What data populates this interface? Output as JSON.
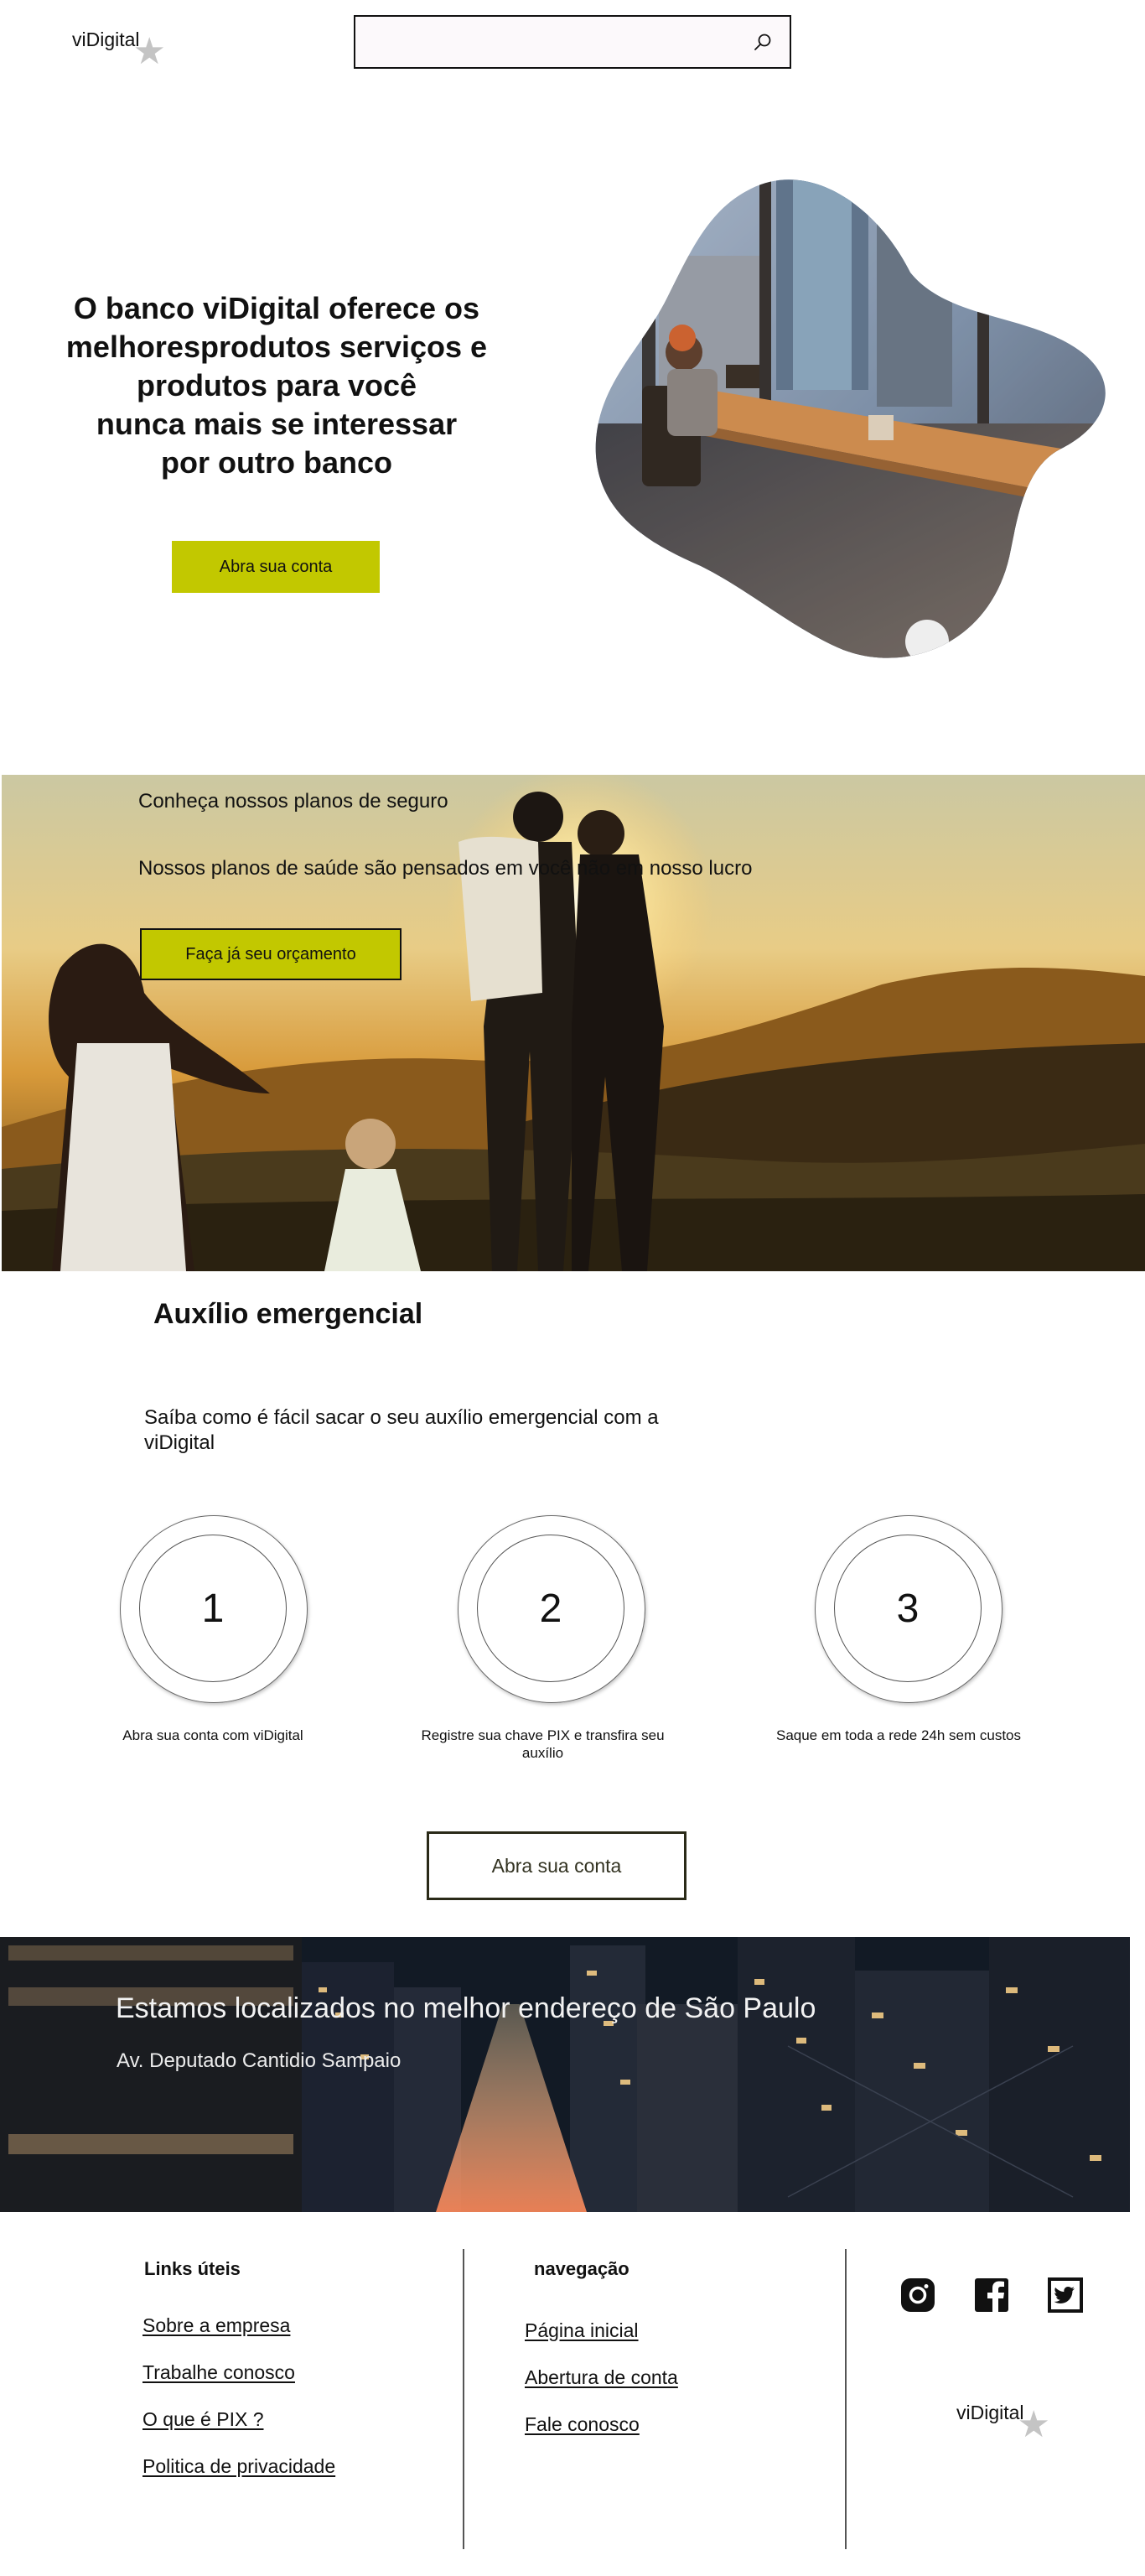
{
  "header": {
    "logo_text": "viDigital",
    "search_placeholder": "",
    "search_icon": "search-icon"
  },
  "hero": {
    "title_lines": [
      "O banco viDigital oferece os",
      "melhoresprodutos serviços e",
      "produtos para você",
      "nunca mais se interessar",
      "por outro banco"
    ],
    "cta_label": "Abra sua conta"
  },
  "insurance": {
    "title": "Conheça nossos planos de seguro",
    "subtitle": "Nossos planos de saúde são pensados em você não em nosso lucro",
    "cta_label": "Faça já seu orçamento"
  },
  "auxilio": {
    "title": "Auxílio emergencial",
    "description": "Saíba como é fácil sacar o seu auxílio emergencial com a viDigital",
    "steps": [
      {
        "number": "1",
        "label": "Abra sua conta com viDigital"
      },
      {
        "number": "2",
        "label": "Registre sua chave PIX  e transfira seu auxílio"
      },
      {
        "number": "3",
        "label": "Saque em toda a rede 24h sem custos"
      }
    ],
    "cta_label": "Abra sua conta"
  },
  "location": {
    "title": "Estamos localizados no melhor endereço de São Paulo",
    "address": "Av. Deputado Cantidio Sampaio"
  },
  "footer": {
    "links_heading": "Links úteis",
    "links": [
      "Sobre a empresa",
      "Trabalhe conosco",
      "O que é PIX ?",
      "Politica de privacidade"
    ],
    "nav_heading": "navegação",
    "nav": [
      "Página inicial",
      "Abertura de conta",
      "Fale conosco"
    ],
    "social_icons": [
      "instagram-icon",
      "facebook-icon",
      "twitter-icon"
    ],
    "logo_text": "viDigital"
  },
  "colors": {
    "accent_yellow": "#c2c800",
    "outline_button": "#2a2a18",
    "logo_star": "#c4c4c4"
  }
}
